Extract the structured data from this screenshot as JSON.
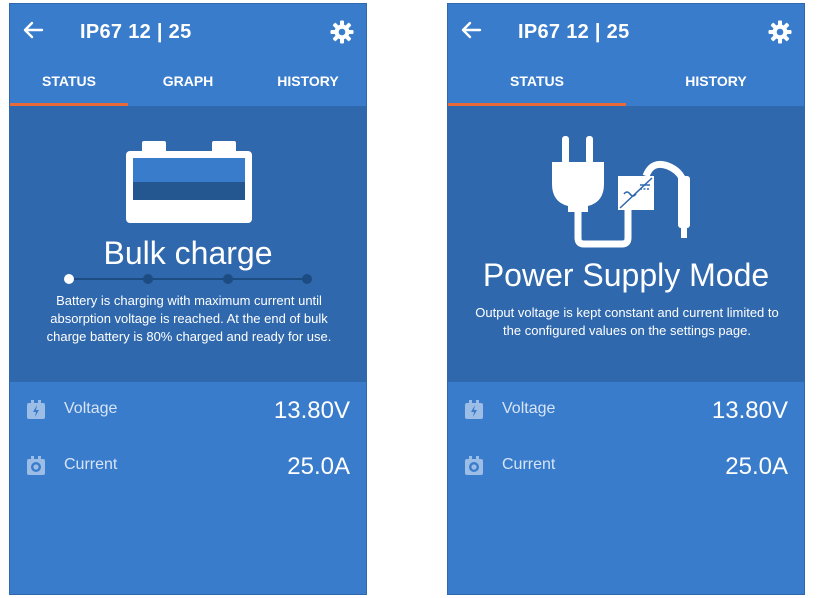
{
  "screens": [
    {
      "title": "IP67 12 | 25",
      "tabs": [
        "STATUS",
        "GRAPH",
        "HISTORY"
      ],
      "active_tab": "STATUS",
      "state_title": "Bulk charge",
      "state_description": "Battery is charging with maximum current until absorption voltage is reached. At the end of bulk charge battery is 80% charged and ready for use.",
      "stage_steps": 4,
      "active_stage": 1,
      "readings": [
        {
          "label": "Voltage",
          "value": "13.80V"
        },
        {
          "label": "Current",
          "value": "25.0A"
        }
      ]
    },
    {
      "title": "IP67 12 | 25",
      "tabs": [
        "STATUS",
        "HISTORY"
      ],
      "active_tab": "STATUS",
      "state_title": "Power Supply Mode",
      "state_description": "Output voltage is kept constant and current limited to the configured values on the settings page.",
      "readings": [
        {
          "label": "Voltage",
          "value": "13.80V"
        },
        {
          "label": "Current",
          "value": "25.0A"
        }
      ]
    }
  ],
  "colors": {
    "panel": "#3a7ccc",
    "hero": "#2f68ad",
    "accent": "#e8693a"
  }
}
